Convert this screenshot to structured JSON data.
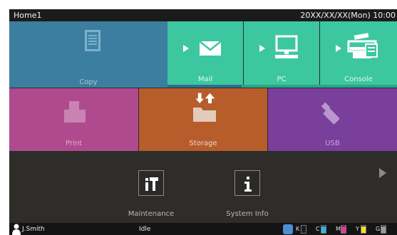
{
  "header": {
    "title": "Home1",
    "datetime": "20XX/XX/XX(Mon) 10:00"
  },
  "tiles": {
    "copy": {
      "label": "Copy",
      "icon": "copy-icon"
    },
    "mail": {
      "label": "Mail",
      "icon": "mail-icon"
    },
    "pc": {
      "label": "PC",
      "icon": "pc-icon"
    },
    "console": {
      "label": "Console",
      "icon": "console-icon"
    },
    "print": {
      "label": "Print",
      "icon": "print-icon"
    },
    "storage": {
      "label": "Storage",
      "icon": "storage-icon"
    },
    "usb": {
      "label": "USB",
      "icon": "usb-icon"
    }
  },
  "apps": {
    "maintenance": {
      "label": "Maintenance",
      "icon": "maintenance-icon"
    },
    "system_info": {
      "label": "System Info",
      "icon": "info-icon"
    }
  },
  "status": {
    "user": "J.Smith",
    "state": "Idle",
    "toner": [
      {
        "letter": "K",
        "color": "#1e1e1e",
        "level": 0.15
      },
      {
        "letter": "C",
        "color": "#29b6e8",
        "level": 0.9
      },
      {
        "letter": "M",
        "color": "#e8369e",
        "level": 0.9
      },
      {
        "letter": "Y",
        "color": "#f2df2a",
        "level": 0.9
      },
      {
        "letter": "G",
        "color": "#9a9a9a",
        "level": 0.9
      }
    ]
  },
  "colors": {
    "copy": "#3e84a7",
    "scan": "#3cc7a0",
    "print": "#b04a8e",
    "storage": "#b65d2b",
    "usb": "#7a3f9a",
    "background": "#2b2a28"
  }
}
